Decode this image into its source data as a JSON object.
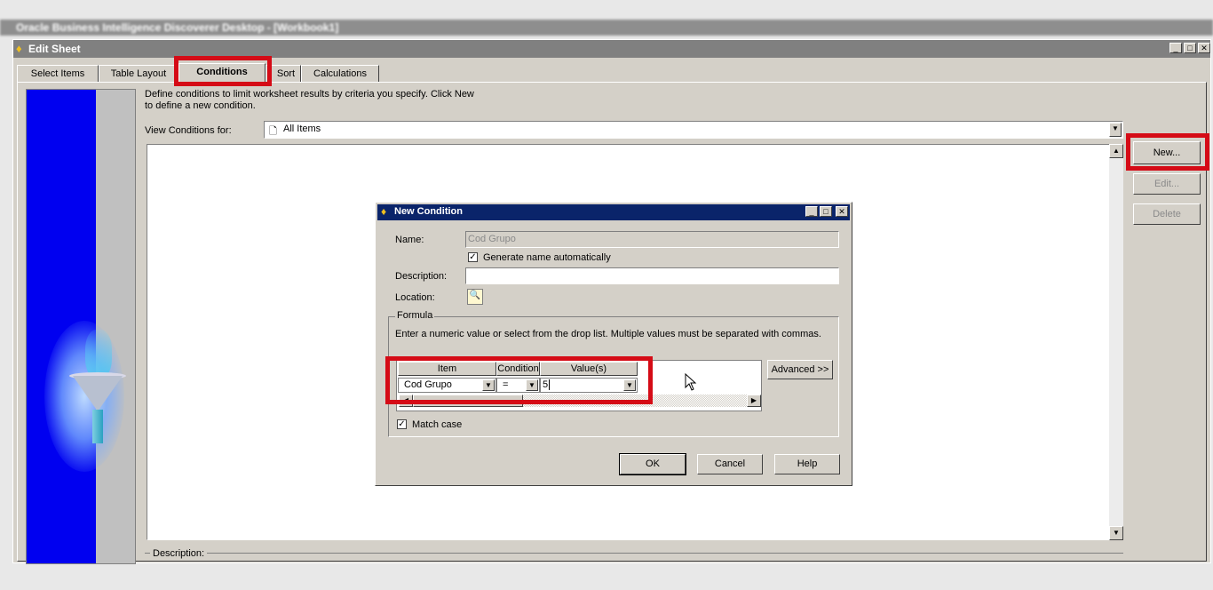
{
  "background_app": {
    "title": "Oracle Business Intelligence Discoverer Desktop - [Workbook1]"
  },
  "window": {
    "title": "Edit Sheet",
    "controls": {
      "minimize": "_",
      "maximize": "□",
      "close": "✕"
    }
  },
  "tabs": [
    {
      "label": "Select Items"
    },
    {
      "label": "Table Layout"
    },
    {
      "label": "Conditions",
      "active": true
    },
    {
      "label": "Sort"
    },
    {
      "label": "Calculations"
    }
  ],
  "intro_text": "Define conditions to limit worksheet results by criteria you specify. Click New to define a new condition.",
  "view_conditions": {
    "label": "View Conditions for:",
    "value": "All Items"
  },
  "side_buttons": {
    "new": "New...",
    "edit": "Edit...",
    "delete": "Delete"
  },
  "description_label": "Description:",
  "dialog": {
    "title": "New Condition",
    "name_label": "Name:",
    "name_value": "Cod Grupo",
    "generate_name_label": "Generate name automatically",
    "generate_name_checked": true,
    "description_label": "Description:",
    "description_value": "",
    "location_label": "Location:",
    "formula": {
      "legend": "Formula",
      "instructions": "Enter a numeric value or select from the drop list. Multiple values must be separated with commas.",
      "columns": {
        "item": "Item",
        "condition": "Condition",
        "values": "Value(s)"
      },
      "row": {
        "item": "Cod Grupo",
        "condition": "=",
        "values": "5"
      },
      "advanced_button": "Advanced >>",
      "match_case_label": "Match case",
      "match_case_checked": true
    },
    "buttons": {
      "ok": "OK",
      "cancel": "Cancel",
      "help": "Help"
    }
  },
  "colors": {
    "highlight": "#d50b16",
    "dialog_title": "#0a246a",
    "banner_blue": "#0000f0",
    "face": "#d4d0c8"
  }
}
